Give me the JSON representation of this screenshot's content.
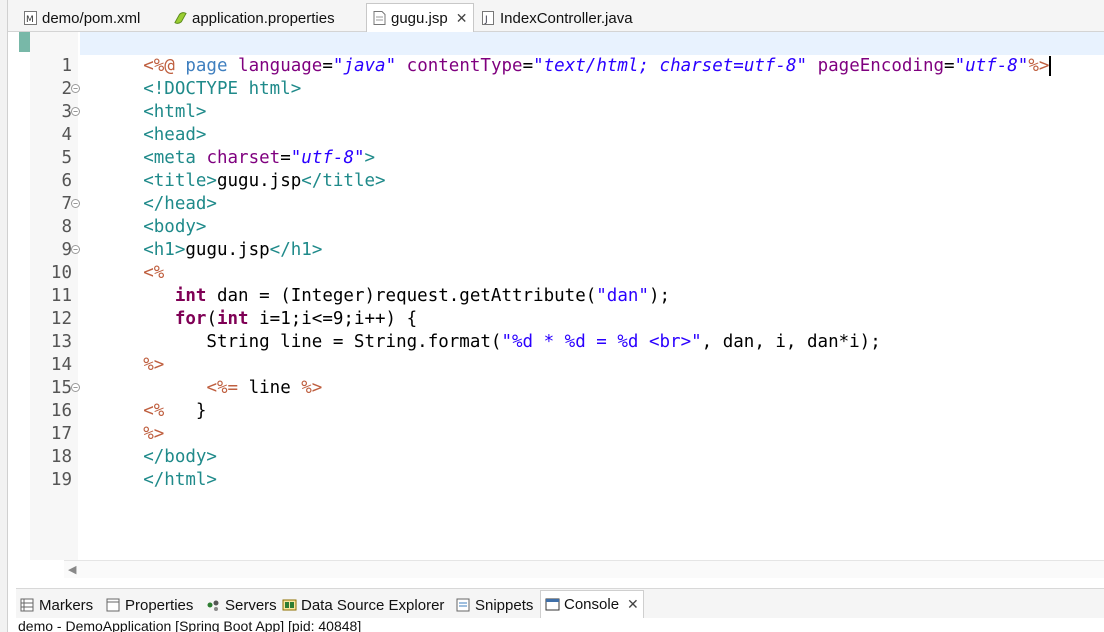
{
  "editor_tabs": [
    {
      "label": "demo/pom.xml",
      "icon": "maven-file-icon"
    },
    {
      "label": "application.properties",
      "icon": "properties-file-icon"
    },
    {
      "label": "gugu.jsp",
      "icon": "jsp-file-icon",
      "active": true
    },
    {
      "label": "IndexController.java",
      "icon": "java-file-icon"
    }
  ],
  "close_glyph": "✕",
  "line_numbers": [
    "1",
    "2",
    "3",
    "4",
    "5",
    "6",
    "7",
    "8",
    "9",
    "10",
    "11",
    "12",
    "13",
    "14",
    "15",
    "16",
    "17",
    "18",
    "19"
  ],
  "code": {
    "l1": [
      "<%@",
      " page ",
      "language",
      "=",
      "\"java\"",
      " ",
      "contentType",
      "=",
      "\"text/html; charset=utf-8\"",
      " ",
      "pageEncoding",
      "=",
      "\"utf-8\"",
      "%>"
    ],
    "l2": [
      "<!DOCTYPE html>"
    ],
    "l3": [
      "<html>"
    ],
    "l4": [
      "<head>"
    ],
    "l5": [
      "<meta",
      " ",
      "charset",
      "=",
      "\"utf-8\"",
      ">"
    ],
    "l6": [
      "<title>",
      "gugu.jsp",
      "</title>"
    ],
    "l7": [
      "</head>"
    ],
    "l8": [
      "<body>"
    ],
    "l9": [
      "<h1>",
      "gugu.jsp",
      "</h1>"
    ],
    "l10": [
      "<%"
    ],
    "l11": [
      "   ",
      "int",
      " dan = (Integer)request.getAttribute(",
      "\"dan\"",
      ");"
    ],
    "l12": [
      "   ",
      "for",
      "(",
      "int",
      " i=1;i<=9;i++) {"
    ],
    "l13": [
      "      String line = String.format(",
      "\"%d * %d = %d <br>\"",
      ", dan, i, dan*i);"
    ],
    "l14": [
      "%>"
    ],
    "l15": [
      "      ",
      "<%=",
      " line ",
      "%>"
    ],
    "l16": [
      "<%",
      "   }"
    ],
    "l17": [
      "%>"
    ],
    "l18": [
      "</body>"
    ],
    "l19": [
      "</html>"
    ]
  },
  "bottom_tabs": [
    {
      "label": "Markers",
      "icon": "markers-icon"
    },
    {
      "label": "Properties",
      "icon": "properties-view-icon"
    },
    {
      "label": "Servers",
      "icon": "servers-icon"
    },
    {
      "label": "Data Source Explorer",
      "icon": "data-source-icon"
    },
    {
      "label": "Snippets",
      "icon": "snippets-icon"
    },
    {
      "label": "Console",
      "icon": "console-icon",
      "active": true
    }
  ],
  "status_text": "demo - DemoApplication [Spring Boot App]  [pid: 40848]",
  "colors": {
    "tag": "#1f8a8a",
    "jsp_delim": "#bf5f3f",
    "attr": "#7f007f",
    "string": "#2a00ff",
    "keyword": "#7f0055",
    "current_line": "#e8f2fe"
  }
}
